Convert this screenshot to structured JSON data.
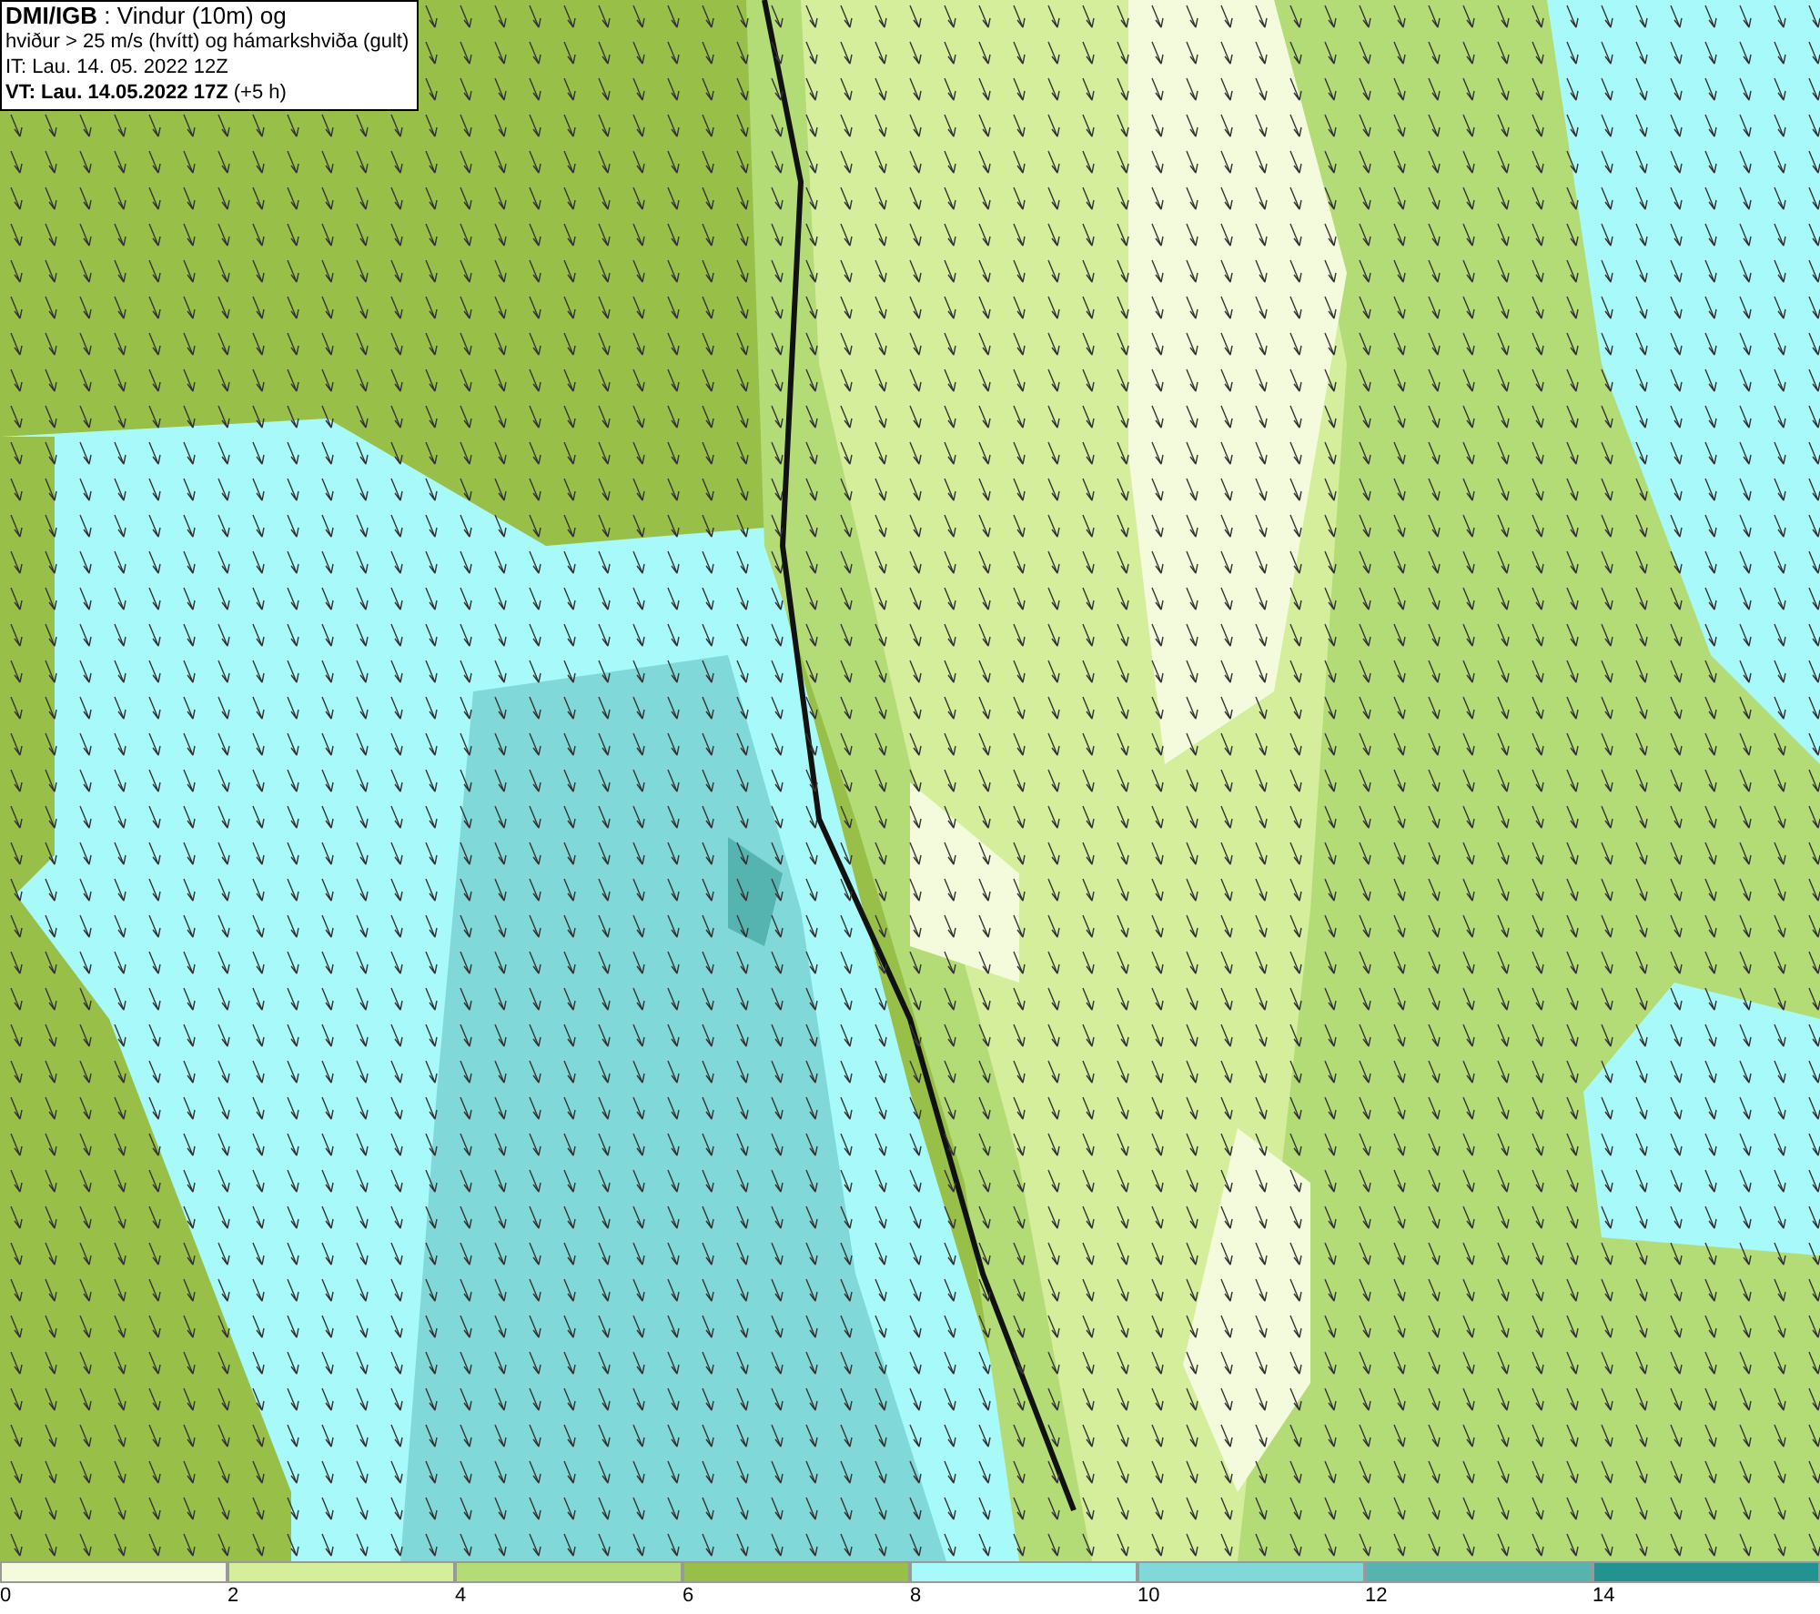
{
  "legend": {
    "lines": [
      "**DMI/IGB** : Vindur (10m) og",
      "hviður > 25 m/s (hvítt) og hámarkshviða (gult)",
      "IT: Lau. 14. 05. 2022 12Z",
      "**VT: Lau. 14.05.2022 17Z** (+5 h)"
    ]
  },
  "colorbar": {
    "bins": [
      {
        "label": "0",
        "color": "#f4fbdc"
      },
      {
        "label": "2",
        "color": "#d4ee9c"
      },
      {
        "label": "4",
        "color": "#b4dc76"
      },
      {
        "label": "6",
        "color": "#98c048"
      },
      {
        "label": "8",
        "color": "#a8fafa"
      },
      {
        "label": "10",
        "color": "#80d8d8"
      },
      {
        "label": "12",
        "color": "#55b3b0"
      },
      {
        "label": "14",
        "color": "#229390"
      }
    ]
  }
}
